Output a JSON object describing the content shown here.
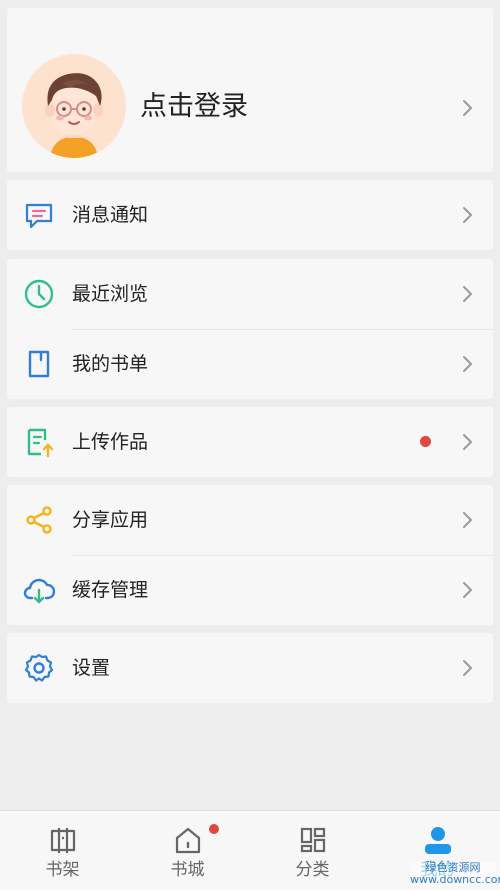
{
  "profile": {
    "login_text": "点击登录"
  },
  "menu": {
    "messages": "消息通知",
    "recent": "最近浏览",
    "booklist": "我的书单",
    "upload": "上传作品",
    "share": "分享应用",
    "cache": "缓存管理",
    "settings": "设置"
  },
  "tabbar": {
    "items": [
      {
        "label": "书架",
        "icon": "bookshelf-icon"
      },
      {
        "label": "书城",
        "icon": "home-icon"
      },
      {
        "label": "分类",
        "icon": "category-icon"
      },
      {
        "label": "我的",
        "icon": "person-icon"
      }
    ]
  },
  "watermark": {
    "line1": "绿色资源网",
    "line2": "www.downcc.com"
  },
  "colors": {
    "accent": "#1e97e6",
    "badge": "#e0473e",
    "icon_message": "#2f7fd6",
    "icon_recent": "#2fbf86",
    "icon_booklist": "#2f7fd6",
    "icon_upload": "#2fbf86",
    "icon_share": "#f2b61c",
    "icon_cache": "#2f7fd6",
    "icon_settings": "#2f7fd6"
  }
}
